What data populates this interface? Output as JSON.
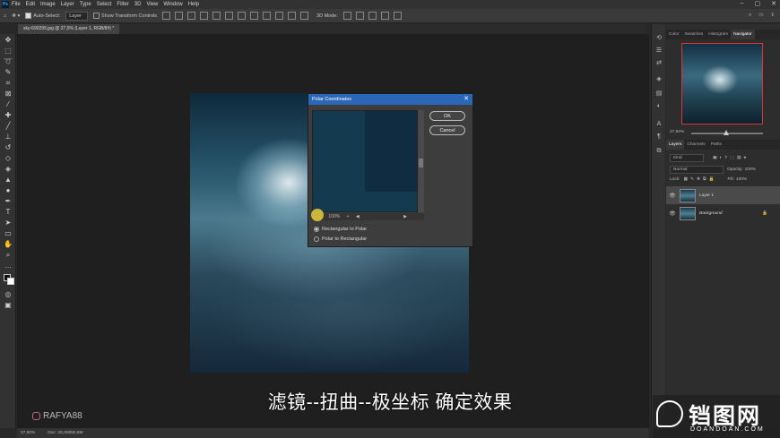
{
  "menu": [
    "File",
    "Edit",
    "Image",
    "Layer",
    "Type",
    "Select",
    "Filter",
    "3D",
    "View",
    "Window",
    "Help"
  ],
  "options": {
    "auto_select": "Auto-Select:",
    "auto_select_target": "Layer",
    "show_transform": "Show Transform Controls",
    "three_d_mode": "3D Mode:"
  },
  "document_tab": "sky-690295.jpg @ 27,5% (Layer 1, RGB/8#) *",
  "dialog": {
    "title": "Polar Coordinates",
    "ok": "OK",
    "cancel": "Cancel",
    "zoom": "100%",
    "options": [
      "Rectangular to Polar",
      "Polar to Rectangular"
    ],
    "selected_option": "Rectangular to Polar"
  },
  "subtitle": "滤镜--扭曲--极坐标 确定效果",
  "watermark_user": "RAFYA88",
  "panel_tabs_top": [
    "Color",
    "Swatches",
    "Histogram",
    "Navigator"
  ],
  "navigator_zoom": "27,50%",
  "panel_tabs_layers": [
    "Layers",
    "Channels",
    "Paths"
  ],
  "layers": {
    "kind": "Kind",
    "blend_mode": "Normal",
    "opacity_label": "Opacity:",
    "opacity_value": "100%",
    "lock_label": "Lock:",
    "fill_label": "Fill:",
    "fill_value": "100%",
    "items": [
      {
        "name": "Layer 1",
        "selected": true
      },
      {
        "name": "Background",
        "locked": true
      }
    ]
  },
  "status": {
    "zoom": "27,50%",
    "doc": "Doc: 25,3M/50,6M"
  },
  "site_watermark": {
    "cn": "铛图网",
    "en": "DOANDOAN.COM"
  },
  "colors": {
    "dialog_title": "#2a67b8",
    "layer_selected": "#4a4a4a",
    "nav_frame": "#dd3333"
  }
}
